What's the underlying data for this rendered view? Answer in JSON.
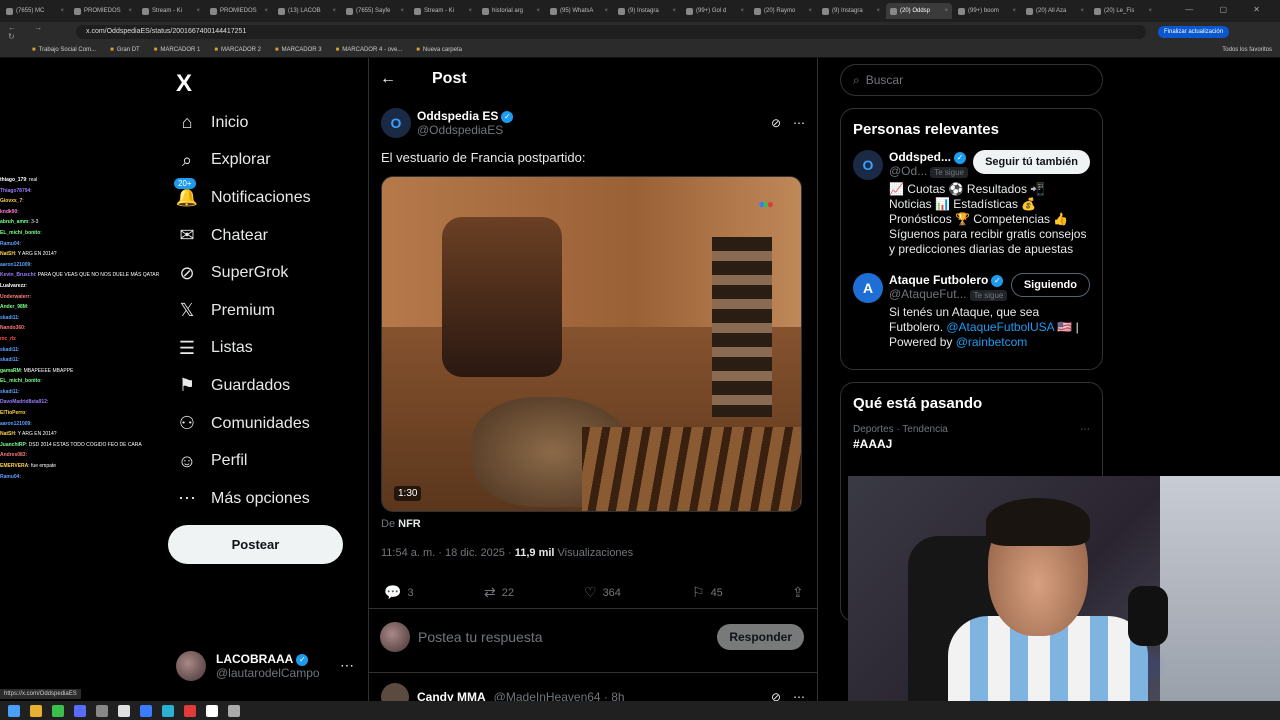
{
  "browser": {
    "tabs": [
      {
        "label": "(7655) MC"
      },
      {
        "label": "PROMIEDOS"
      },
      {
        "label": "Stream - Ki"
      },
      {
        "label": "PROMIEDOS"
      },
      {
        "label": "(13) LACOB"
      },
      {
        "label": "(7655) Sayfe"
      },
      {
        "label": "Stream - Ki"
      },
      {
        "label": "historial arg"
      },
      {
        "label": "(95) WhatsA"
      },
      {
        "label": "(9) Instagra"
      },
      {
        "label": "(99+) Gol d"
      },
      {
        "label": "(20) Raymo"
      },
      {
        "label": "(9) Instagra"
      },
      {
        "label": "(20) Oddsp",
        "active": true
      },
      {
        "label": "(99+) boom"
      },
      {
        "label": "(20) All Aza"
      },
      {
        "label": "(20) Le_Fis"
      }
    ],
    "url": "x.com/OddspediaES/status/2001667400144417251",
    "update_button": "Finalizar actualización",
    "bookmarks": [
      "Trabajo Social Com...",
      "Gran DT",
      "MARCADOR 1",
      "MARCADOR 2",
      "MARCADOR 3",
      "MARCADOR 4 - ove...",
      "Nueva carpeta"
    ],
    "all_bookmarks": "Todos los favoritos",
    "status_url": "https://x.com/OddspediaES"
  },
  "chat": [
    {
      "user": "thiago_179",
      "color": "#ffffff",
      "msg": "real"
    },
    {
      "user": "Thiago78794",
      "color": "#9b7bff",
      "msg": ""
    },
    {
      "user": "Giovxx_7",
      "color": "#ffd24a",
      "msg": ""
    },
    {
      "user": "kndk90",
      "color": "#ff7ad9",
      "msg": ""
    },
    {
      "user": "abruh_amm",
      "color": "#7aff8a",
      "msg": "3-3"
    },
    {
      "user": "EL_michi_bonito",
      "color": "#7aff8a",
      "msg": ""
    },
    {
      "user": "Ramu04",
      "color": "#5aa0ff",
      "msg": ""
    },
    {
      "user": "NatSH",
      "color": "#ffd24a",
      "msg": "Y ARG EN 2014?"
    },
    {
      "user": "aaron121009",
      "color": "#5aa0ff",
      "msg": ""
    },
    {
      "user": "Kevin_Bruschi",
      "color": "#9b7bff",
      "msg": "PARA QUE VEAS QUE NO NOS DUELE MÁS QATAR"
    },
    {
      "user": "Lualvarezz",
      "color": "#ffffff",
      "msg": ""
    },
    {
      "user": "Underwaterr",
      "color": "#ff7a7a",
      "msg": ""
    },
    {
      "user": "Ander_98M",
      "color": "#7aff8a",
      "msg": ""
    },
    {
      "user": "skadi11",
      "color": "#5aa0ff",
      "msg": ""
    },
    {
      "user": "Nando360",
      "color": "#ff7a7a",
      "msg": ""
    },
    {
      "user": "mc_rb",
      "color": "#ff4a4a",
      "msg": ""
    },
    {
      "user": "skadi11",
      "color": "#5aa0ff",
      "msg": ""
    },
    {
      "user": "skadi11",
      "color": "#5aa0ff",
      "msg": ""
    },
    {
      "user": "gamaRM",
      "color": "#7aff8a",
      "msg": "MBAPEEEE MBAPPE"
    },
    {
      "user": "EL_michi_bonito",
      "color": "#7aff8a",
      "msg": ""
    },
    {
      "user": "skadi11",
      "color": "#5aa0ff",
      "msg": ""
    },
    {
      "user": "DavoMadrid8sta912",
      "color": "#9b7bff",
      "msg": ""
    },
    {
      "user": "ElTioPerro",
      "color": "#ffd24a",
      "msg": ""
    },
    {
      "user": "aaron121009",
      "color": "#5aa0ff",
      "msg": ""
    },
    {
      "user": "NatSH",
      "color": "#ffd24a",
      "msg": "Y ARG EN 2014?"
    },
    {
      "user": "JuanchiRP",
      "color": "#7aff8a",
      "msg": "DSD 2014 ESTAS TODO COGIDO FEO DE CARA"
    },
    {
      "user": "Andres083",
      "color": "#ff7a7a",
      "msg": ""
    },
    {
      "user": "EMERVERA",
      "color": "#ffd24a",
      "msg": "fue empate"
    },
    {
      "user": "Ramu04",
      "color": "#5aa0ff",
      "msg": ""
    }
  ],
  "nav": {
    "logo": "X",
    "items": [
      {
        "label": "Inicio",
        "icon": "⌂"
      },
      {
        "label": "Explorar",
        "icon": "⌕"
      },
      {
        "label": "Notificaciones",
        "icon": "🔔",
        "badge": "20+"
      },
      {
        "label": "Chatear",
        "icon": "✉"
      },
      {
        "label": "SuperGrok",
        "icon": "⊘"
      },
      {
        "label": "Premium",
        "icon": "𝕏"
      },
      {
        "label": "Listas",
        "icon": "☰"
      },
      {
        "label": "Guardados",
        "icon": "⚑"
      },
      {
        "label": "Comunidades",
        "icon": "⚇"
      },
      {
        "label": "Perfil",
        "icon": "☺"
      },
      {
        "label": "Más opciones",
        "icon": "⋯"
      }
    ],
    "post_button": "Postear",
    "account": {
      "name": "LACOBRAAA",
      "handle": "@lautarodelCampo"
    }
  },
  "post": {
    "header": "Post",
    "author": {
      "name": "Oddspedia ES",
      "handle": "@OddspediaES",
      "avatar_letter": "O"
    },
    "text": "El vestuario de Francia postpartido:",
    "video_duration": "1:30",
    "from_prefix": "De",
    "from_source": "NFR",
    "time": "11:54 a. m. · 18 dic. 2025 ·",
    "views_count": "11,9 mil",
    "views_label": "Visualizaciones",
    "stats": {
      "replies": "3",
      "reposts": "22",
      "likes": "364",
      "bookmarks": "45"
    },
    "reply_placeholder": "Postea tu respuesta",
    "reply_button": "Responder"
  },
  "next_post": {
    "name": "Candy MMA",
    "handle": "@MadeInHeaven64 · 8h"
  },
  "right": {
    "search_placeholder": "Buscar",
    "relevant_title": "Personas relevantes",
    "people": [
      {
        "name": "Oddsped...",
        "handle": "@Od...",
        "follows_you": "Te sigue",
        "button": "Seguir tú también",
        "bio": "📈 Cuotas ⚽ Resultados 📲 Noticias 📊 Estadísticas 💰 Pronósticos 🏆 Competencias 👍 Síguenos para recibir gratis consejos y predicciones diarias de apuestas"
      },
      {
        "name": "Ataque Futbolero",
        "handle": "@AtaqueFut...",
        "follows_you": "Te sigue",
        "button": "Siguiendo",
        "bio_text": "Si tenés un Ataque, que sea Futbolero.",
        "bio_link1": "@AtaqueFutbolUSA",
        "bio_mid": " 🇺🇸 | Powered by ",
        "bio_link2": "@rainbetcom"
      }
    ],
    "trending_title": "Qué está pasando",
    "trend": {
      "meta": "Deportes · Tendencia",
      "tag": "#AAAJ"
    }
  },
  "colors": {
    "accent": "#1d9bf0",
    "background": "#000000",
    "border": "#2f3336",
    "muted": "#71767b"
  }
}
